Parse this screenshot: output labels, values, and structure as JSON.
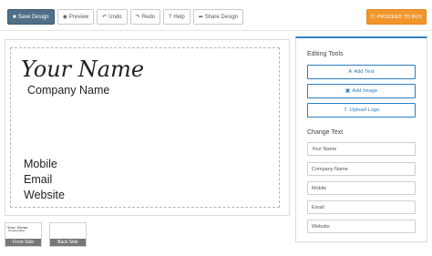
{
  "toolbar": {
    "buttons": [
      {
        "label": "Save Design",
        "icon": "save-icon",
        "glyph": "■"
      },
      {
        "label": "Preview",
        "icon": "eye-icon",
        "glyph": "◉"
      },
      {
        "label": "Undo",
        "icon": "undo-icon",
        "glyph": "↶"
      },
      {
        "label": "Redo",
        "icon": "redo-icon",
        "glyph": "↷"
      },
      {
        "label": "Help",
        "icon": "help-icon",
        "glyph": "?"
      },
      {
        "label": "Share Design",
        "icon": "share-icon",
        "glyph": "➦"
      }
    ],
    "proceed_label": "PROCEED TO BUY",
    "proceed_glyph": "☷"
  },
  "card": {
    "name": "Your Name",
    "company": "Company Name",
    "mobile": "Mobile",
    "email": "Email",
    "website": "Website"
  },
  "thumbnails": {
    "front_label": "Front Side",
    "back_label": "Back Side",
    "front_mini_name": "Your Name",
    "front_mini_company": "Company Name"
  },
  "editing_tools": {
    "title": "Editing Tools",
    "add_text": "Add Text",
    "add_text_glyph": "A",
    "add_image": "Add Image",
    "add_image_glyph": "▣",
    "upload_logo": "Upload Logo",
    "upload_logo_glyph": "⇪"
  },
  "change_text": {
    "title": "Change Text",
    "fields": [
      {
        "placeholder": "Your Name"
      },
      {
        "placeholder": "Company Name"
      },
      {
        "placeholder": "Mobile"
      },
      {
        "placeholder": "Email"
      },
      {
        "placeholder": "Website"
      }
    ]
  },
  "colors": {
    "save_button": "#4f6f88",
    "proceed_button": "#f0962c",
    "accent_blue": "#2b7fc0"
  }
}
